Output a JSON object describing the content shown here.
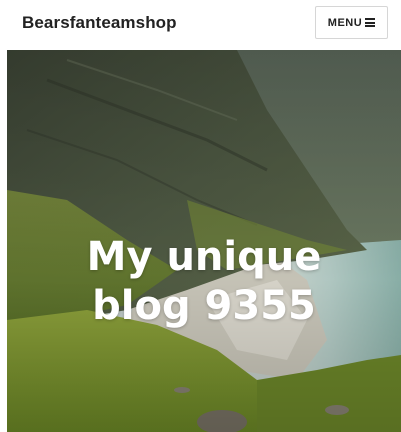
{
  "header": {
    "site_title": "Bearsfanteamshop",
    "menu_label": "MENU"
  },
  "hero": {
    "title_line1": "My unique",
    "title_line2": "blog 9355",
    "image_description": ""
  },
  "colors": {
    "title_text": "#222222",
    "hero_text": "#ffffff",
    "button_border": "#d6d6d6"
  },
  "icons": {
    "menu": "hamburger-icon"
  }
}
